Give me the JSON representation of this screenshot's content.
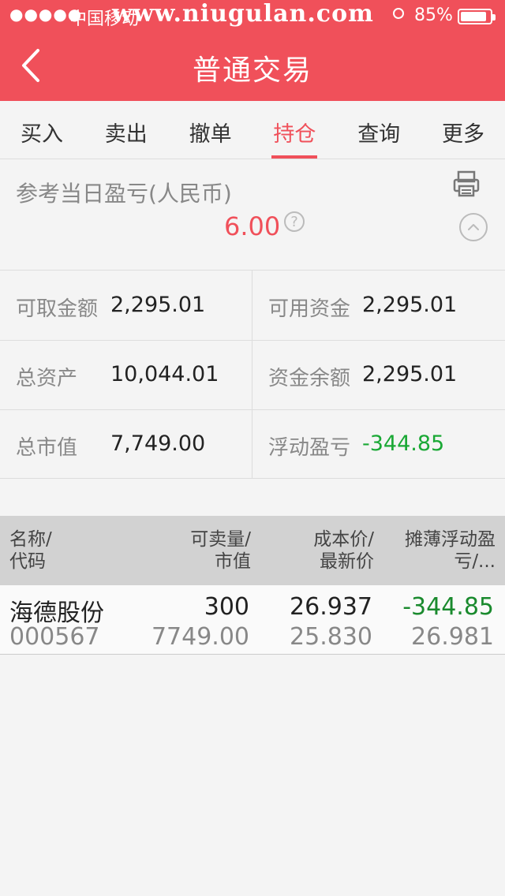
{
  "status": {
    "carrier": "中国移动",
    "watermark": "www.niugulan.com",
    "battery": "85%",
    "battery_level": 0.85
  },
  "header": {
    "title": "普通交易"
  },
  "tabs": [
    {
      "label": "买入"
    },
    {
      "label": "卖出"
    },
    {
      "label": "撤单"
    },
    {
      "label": "持仓"
    },
    {
      "label": "查询"
    },
    {
      "label": "更多"
    }
  ],
  "active_tab": "持仓",
  "daily_pl": {
    "label": "参考当日盈亏(人民币)",
    "value": "6.00",
    "help": "?"
  },
  "account": {
    "withdrawable_label": "可取金额",
    "withdrawable_value": "2,295.01",
    "available_label": "可用资金",
    "available_value": "2,295.01",
    "total_assets_label": "总资产",
    "total_assets_value": "10,044.01",
    "balance_label": "资金余额",
    "balance_value": "2,295.01",
    "market_value_label": "总市值",
    "market_value_value": "7,749.00",
    "floating_pl_label": "浮动盈亏",
    "floating_pl_value": "-344.85"
  },
  "table": {
    "headers": {
      "name_1": "名称/",
      "name_2": "代码",
      "qty_1": "可卖量/",
      "qty_2": "市值",
      "price_1": "成本价/",
      "price_2": "最新价",
      "pl_1": "摊薄浮动盈",
      "pl_2": "亏/..."
    },
    "rows": [
      {
        "name": "海德股份",
        "code": "000567",
        "qty": "300",
        "market_value": "7749.00",
        "cost": "26.937",
        "latest": "25.830",
        "pl": "-344.85",
        "pl_sub": "26.981"
      }
    ]
  },
  "colors": {
    "brand": "#f0505a",
    "negative": "#1aa835"
  }
}
